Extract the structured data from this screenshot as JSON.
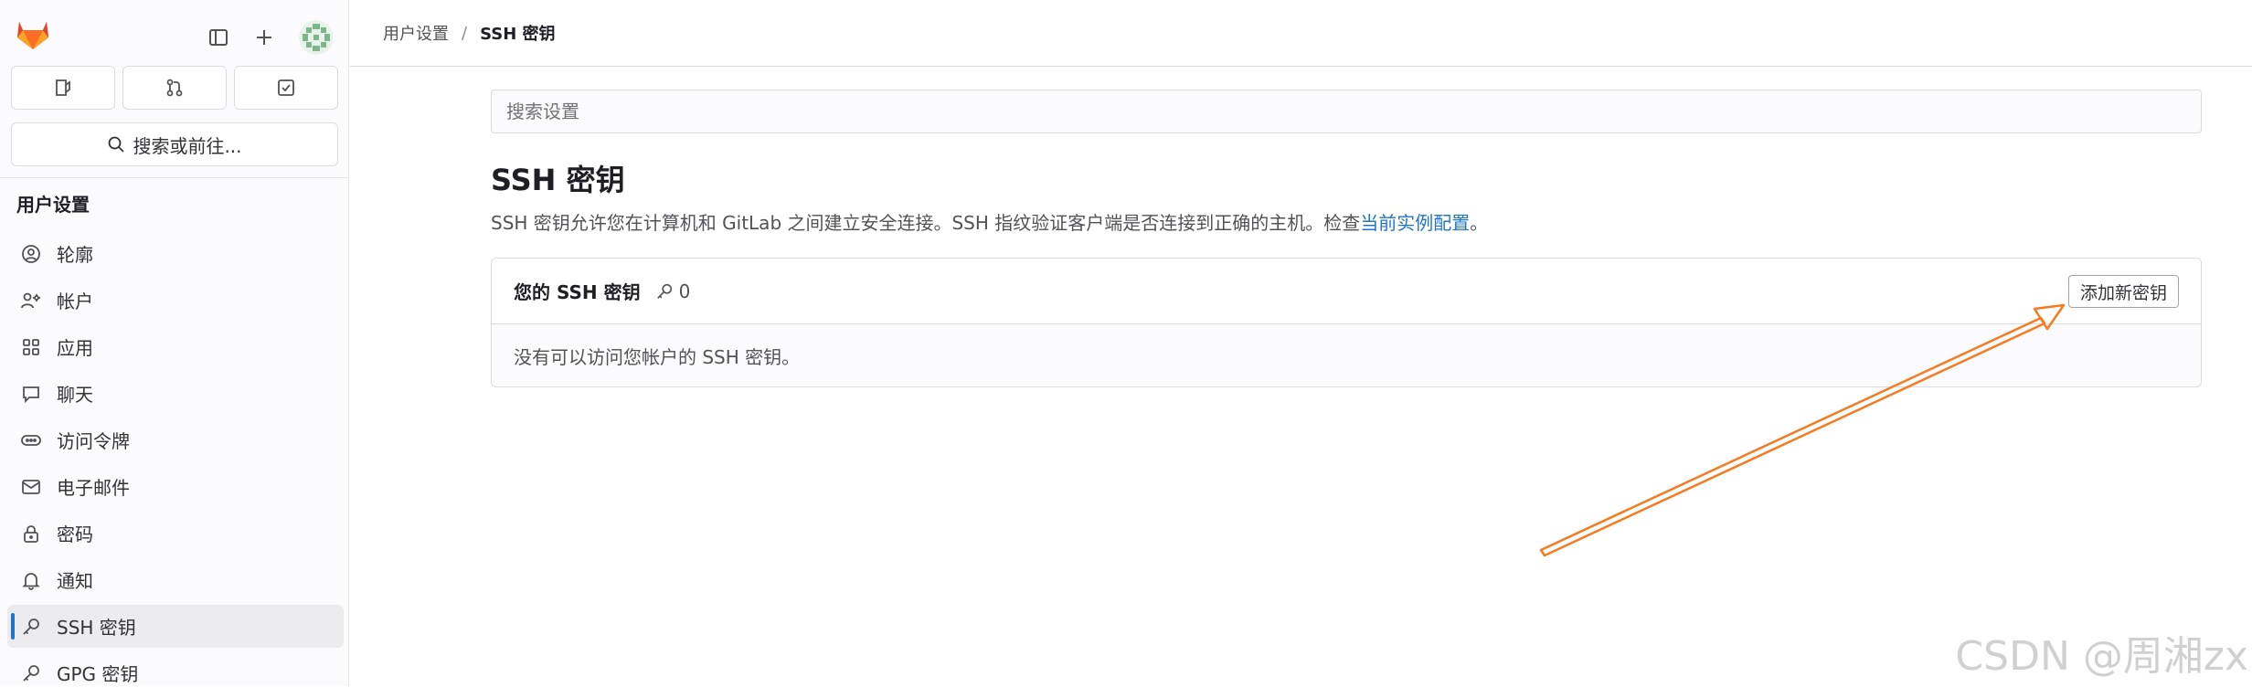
{
  "colors": {
    "accent": "#1f75cb",
    "annotation_arrow": "#f47b20",
    "sidebar_bg": "#fbfafd",
    "active_item_bg": "#ececef"
  },
  "sidebar": {
    "logo_icon": "gitlab-tanuki-icon",
    "top_icons": [
      "sidebar-toggle-icon",
      "plus-icon",
      "avatar"
    ],
    "quick_buttons": [
      "issues-icon",
      "merge-requests-icon",
      "todos-icon"
    ],
    "search_label": "搜索或前往...",
    "section_title": "用户设置",
    "items": [
      {
        "label": "轮廓",
        "icon": "profile-icon"
      },
      {
        "label": "帐户",
        "icon": "account-icon"
      },
      {
        "label": "应用",
        "icon": "applications-icon"
      },
      {
        "label": "聊天",
        "icon": "chat-icon"
      },
      {
        "label": "访问令牌",
        "icon": "token-icon"
      },
      {
        "label": "电子邮件",
        "icon": "mail-icon"
      },
      {
        "label": "密码",
        "icon": "lock-icon"
      },
      {
        "label": "通知",
        "icon": "bell-icon"
      },
      {
        "label": "SSH 密钥",
        "icon": "key-icon",
        "active": true
      },
      {
        "label": "GPG 密钥",
        "icon": "key-icon"
      }
    ]
  },
  "breadcrumb": {
    "items": [
      "用户设置",
      "SSH 密钥"
    ],
    "separator": "/"
  },
  "main": {
    "search_placeholder": "搜索设置",
    "title": "SSH 密钥",
    "description": "SSH 密钥允许您在计算机和 GitLab 之间建立安全连接。SSH 指纹验证客户端是否连接到正确的主机。检查",
    "description_link": "当前实例配置",
    "description_end": "。",
    "card": {
      "title": "您的 SSH 密钥",
      "count": "0",
      "add_button": "添加新密钥",
      "empty_text": "没有可以访问您帐户的 SSH 密钥。"
    }
  },
  "watermark": "CSDN @周湘zx"
}
